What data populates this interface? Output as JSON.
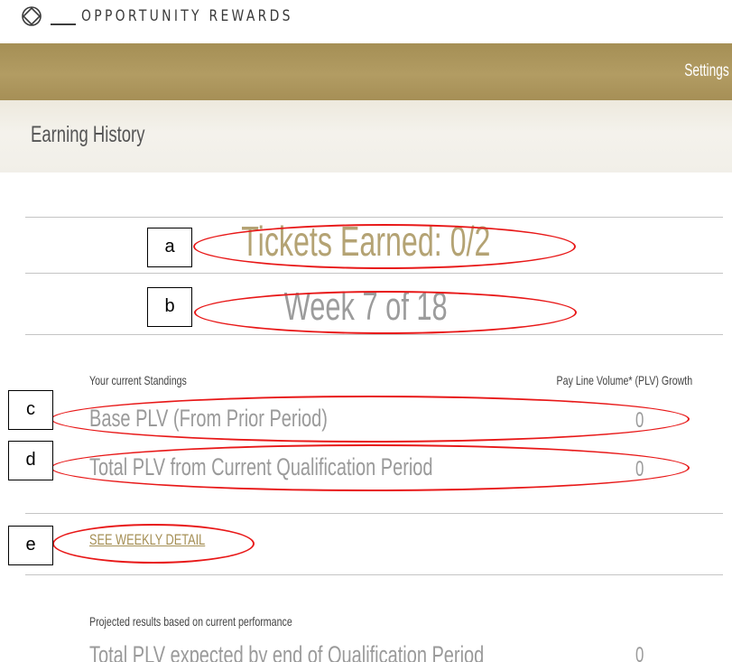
{
  "brand": {
    "name": "OPPORTUNITY REWARDS",
    "icon": "diamond-circle-logo-icon"
  },
  "nav": {
    "settings_label": "Settings"
  },
  "header": {
    "title": "Earning History"
  },
  "summary": {
    "tickets_earned": "Tickets Earned: 0/2",
    "week": "Week 7 of 18"
  },
  "standings": {
    "heading": "Your current Standings",
    "column_heading": "Pay Line Volume* (PLV) Growth",
    "rows": [
      {
        "label": "Base PLV (From Prior Period)",
        "value": "0"
      },
      {
        "label": "Total PLV from Current Qualification Period",
        "value": "0"
      }
    ]
  },
  "weekly_detail_link": "SEE WEEKLY DETAIL",
  "projected": {
    "heading": "Projected results based on current performance",
    "rows": [
      {
        "label": "Total PLV expected by end of Qualification Period",
        "value": "0"
      }
    ]
  },
  "annotations": {
    "callouts": [
      "a",
      "b",
      "c",
      "d",
      "e"
    ],
    "highlight_color": "#e81818"
  },
  "colors": {
    "brand_gold": "#a58f55",
    "tickets_text": "#b4a374",
    "muted_text": "#9a9a9a"
  }
}
